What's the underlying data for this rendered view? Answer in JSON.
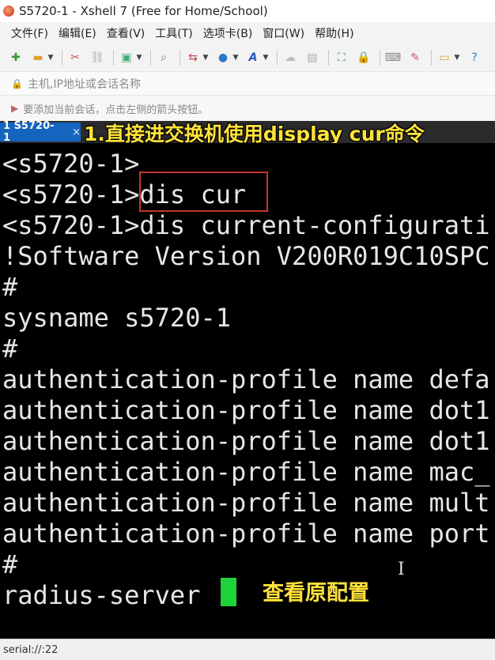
{
  "window": {
    "title": "S5720-1 - Xshell 7 (Free for Home/School)"
  },
  "menu": [
    "文件(F)",
    "编辑(E)",
    "查看(V)",
    "工具(T)",
    "选项卡(B)",
    "窗口(W)",
    "帮助(H)"
  ],
  "toolbar_icons": [
    "new-session-icon",
    "open-folder-icon",
    "disconnect-icon",
    "reconnect-icon",
    "properties-icon",
    "find-icon",
    "transfer-icon",
    "globe-icon",
    "font-icon",
    "script-icon",
    "screenshot-icon",
    "fullscreen-icon",
    "lock-icon",
    "keyboard-icon",
    "highlight-icon",
    "compose-icon",
    "help-icon"
  ],
  "address": {
    "placeholder": "主机,IP地址或会话名称"
  },
  "hint": {
    "text": "要添加当前会话，点击左侧的箭头按钮。"
  },
  "tab": {
    "label": "1 S5720-1",
    "close": "×"
  },
  "captions": {
    "top": "1.直接进交换机使用display cur命令",
    "bottom": "查看原配置"
  },
  "terminal": {
    "lines": [
      "<s5720-1>",
      "<s5720-1>dis cur",
      "<s5720-1>dis current-configurati",
      "!Software Version V200R019C10SPC",
      "#",
      "sysname s5720-1",
      "#",
      "authentication-profile name defa",
      "authentication-profile name dot1",
      "authentication-profile name dot1",
      "authentication-profile name mac_",
      "authentication-profile name mult",
      "authentication-profile name port",
      "#",
      "radius-server "
    ]
  },
  "status": {
    "text": "serial://:22"
  },
  "colors": {
    "caption": "#ffe23a",
    "cursor": "#1ed23a",
    "tab_active": "#1565c0",
    "highlight_box": "#c8352a"
  }
}
